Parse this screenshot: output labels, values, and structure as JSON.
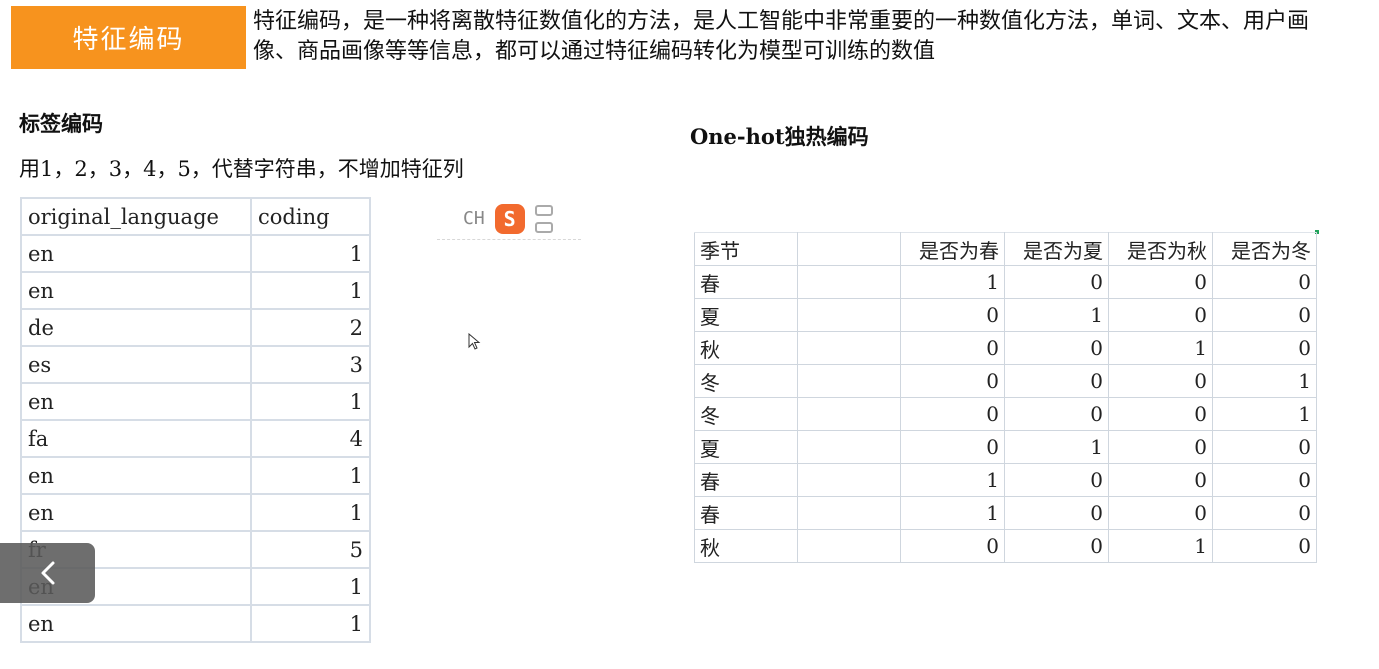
{
  "header": {
    "badge_label": "特征编码",
    "intro": "特征编码，是一种将离散特征数值化的方法，是人工智能中非常重要的一种数值化方法，单词、文本、用户画像、商品画像等等信息，都可以通过特征编码转化为模型可训练的数值",
    "accent_color": "#f7931e"
  },
  "label_encoding": {
    "title": "标签编码",
    "description": "用1，2，3，4，5，代替字符串，不增加特征列",
    "table": {
      "headers": [
        "original_language",
        "coding"
      ],
      "rows": [
        [
          "en",
          "1"
        ],
        [
          "en",
          "1"
        ],
        [
          "de",
          "2"
        ],
        [
          "es",
          "3"
        ],
        [
          "en",
          "1"
        ],
        [
          "fa",
          "4"
        ],
        [
          "en",
          "1"
        ],
        [
          "en",
          "1"
        ],
        [
          "fr",
          "5"
        ],
        [
          "en",
          "1"
        ],
        [
          "en",
          "1"
        ]
      ]
    }
  },
  "onehot": {
    "title": "One-hot独热编码",
    "table": {
      "headers": [
        "季节",
        "",
        "是否为春",
        "是否为夏",
        "是否为秋",
        "是否为冬"
      ],
      "rows": [
        [
          "春",
          "",
          "1",
          "0",
          "0",
          "0"
        ],
        [
          "夏",
          "",
          "0",
          "1",
          "0",
          "0"
        ],
        [
          "秋",
          "",
          "0",
          "0",
          "1",
          "0"
        ],
        [
          "冬",
          "",
          "0",
          "0",
          "0",
          "1"
        ],
        [
          "冬",
          "",
          "0",
          "0",
          "0",
          "1"
        ],
        [
          "夏",
          "",
          "0",
          "1",
          "0",
          "0"
        ],
        [
          "春",
          "",
          "1",
          "0",
          "0",
          "0"
        ],
        [
          "春",
          "",
          "1",
          "0",
          "0",
          "0"
        ],
        [
          "秋",
          "",
          "0",
          "0",
          "1",
          "0"
        ]
      ]
    }
  },
  "ime": {
    "mode_label": "CH",
    "logo_letter": "S",
    "logo_color": "#f26a2e",
    "icon": "ime-logo-icon"
  },
  "overlay": {
    "collapse_icon": "chevron-left-icon",
    "cursor_icon": "mouse-pointer-icon"
  }
}
